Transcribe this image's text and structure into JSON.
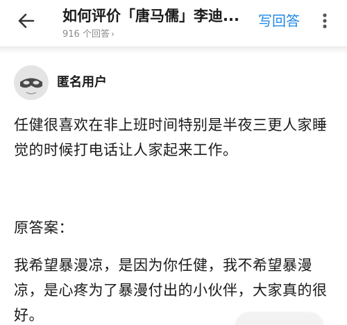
{
  "header": {
    "back_icon": "arrow-left-icon",
    "title": "如何评价「唐马儒」李迪...",
    "answer_count": "916 个回答",
    "chevron": "›",
    "write_answer_label": "写回答",
    "more_icon": "more-vertical-icon",
    "accent": "#1e88e5"
  },
  "author": {
    "avatar_icon": "anonymous-mask-avatar",
    "name": "匿名用户"
  },
  "answer": {
    "paragraph_1": "任健很喜欢在非上班时间特别是半夜三更人家睡觉的时候打电话让人家起来工作。",
    "paragraph_2": "原答案：",
    "paragraph_3": "我希望暴漫凉，是因为你任健，我不希望暴漫凉，是心疼为了暴漫付出的小伙伴，大家真的很好。"
  }
}
